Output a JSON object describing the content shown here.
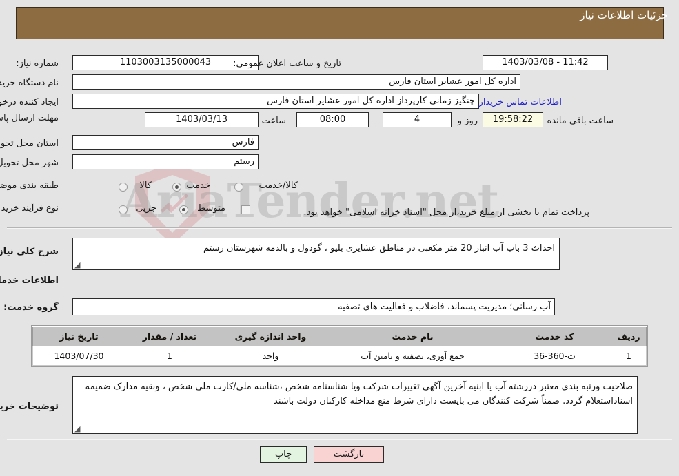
{
  "header": {
    "title": "جزئیات اطلاعات نیاز"
  },
  "watermark": {
    "text": "AriaTender.net"
  },
  "fields": {
    "need_number_label": "شماره نیاز:",
    "need_number_value": "1103003135000043",
    "public_announce_label": "تاریخ و ساعت اعلان عمومی:",
    "public_announce_value": "1403/03/08 - 11:42",
    "buyer_org_label": "نام دستگاه خریدار:",
    "buyer_org_value": "اداره کل امور عشایر استان فارس",
    "creator_label": "ایجاد کننده درخواست:",
    "creator_value": "چنگیز زمانی کارپرداز اداره کل امور عشایر استان فارس",
    "contact_link": "اطلاعات تماس خریدار",
    "deadline_label": "مهلت ارسال پاسخ: تا تاریخ:",
    "deadline_date": "1403/03/13",
    "hour_label": "ساعت",
    "deadline_time": "08:00",
    "days_value": "4",
    "days_label": "روز و",
    "timer_value": "19:58:22",
    "remaining_label": "ساعت باقی مانده",
    "province_label": "استان محل تحویل:",
    "province_value": "فارس",
    "city_label": "شهر محل تحویل:",
    "city_value": "رستم",
    "category_label": "طبقه بندی موضوعی:",
    "category_options": [
      "کالا",
      "خدمت",
      "کالا/خدمت"
    ],
    "category_selected": "خدمت",
    "process_label": "نوع فرآیند خرید :",
    "process_options": [
      "جزیی",
      "متوسط"
    ],
    "process_selected": "متوسط",
    "treasury_checkbox_label": "پرداخت تمام یا بخشی از مبلغ خرید،از محل \"اسناد خزانه اسلامی\" خواهد بود.",
    "treasury_checked": false
  },
  "sections": {
    "general_desc_label": "شرح کلی نیاز:",
    "general_desc_value": "احداث 3 باب آب انبار 20 متر مکعبی در مناطق عشایری بلیو ، گودول و بالدمه شهرستان رستم",
    "services_info_title": "اطلاعات خدمات مورد نیاز",
    "service_group_label": "گروه خدمت:",
    "service_group_value": "آب رسانی؛ مدیریت پسماند، فاضلاب و فعالیت های تصفیه",
    "buyer_notes_label": "توضیحات خریدار:",
    "buyer_notes_value": "صلاحیت ورتبه بندی معتبر دررشته آب یا ابنیه  آخرین آگهی تغییرات شرکت ویا شناسنامه شخص ،شناسه ملی/کارت ملی شخص ، وبقیه مدارک  ضمیمه اسناداستعلام گردد. ضمناً شرکت کنندگان می بایست دارای شرط منع مداخله کارکنان دولت باشند"
  },
  "table": {
    "headers": [
      "ردیف",
      "کد خدمت",
      "نام خدمت",
      "واحد اندازه گیری",
      "تعداد / مقدار",
      "تاریخ نیاز"
    ],
    "rows": [
      {
        "row": "1",
        "code": "ث-360-36",
        "name": "جمع آوری، تصفیه و تامین آب",
        "unit": "واحد",
        "qty": "1",
        "need_date": "1403/07/30"
      }
    ]
  },
  "buttons": {
    "print": "چاپ",
    "back": "بازگشت"
  }
}
